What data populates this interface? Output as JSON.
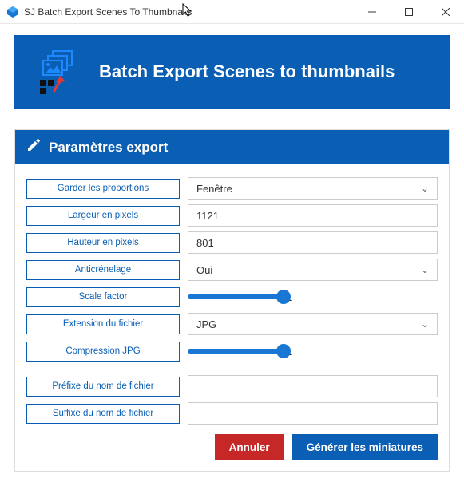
{
  "window": {
    "title": "SJ Batch Export Scenes To Thumbnails"
  },
  "banner": {
    "title": "Batch Export Scenes to thumbnails"
  },
  "panel": {
    "title": "Paramètres export"
  },
  "labels": {
    "keep_proportions": "Garder les proportions",
    "width_px": "Largeur en pixels",
    "height_px": "Hauteur en pixels",
    "antialias": "Anticrénelage",
    "scale_factor": "Scale factor",
    "file_ext": "Extension du fichier",
    "jpg_compression": "Compression JPG",
    "prefix": "Préfixe du nom de fichier",
    "suffix": "Suffixe du nom de fichier"
  },
  "values": {
    "keep_proportions": "Fenêtre",
    "width_px": "1121",
    "height_px": "801",
    "antialias": "Oui",
    "scale_factor": "1",
    "file_ext": "JPG",
    "jpg_compression": "1",
    "prefix": "",
    "suffix": ""
  },
  "buttons": {
    "cancel": "Annuler",
    "generate": "Générer les miniatures"
  }
}
